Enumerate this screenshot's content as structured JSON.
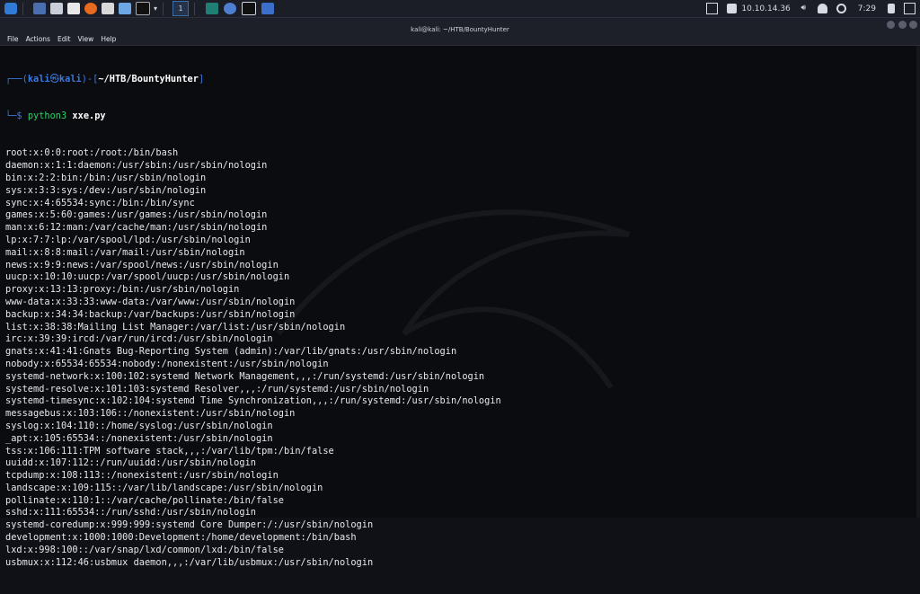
{
  "taskbar": {
    "workspace": "1",
    "ip": "10.10.14.36",
    "time": "7:29"
  },
  "window": {
    "title": "kali@kali: ~/HTB/BountyHunter",
    "menu": [
      "File",
      "Actions",
      "Edit",
      "View",
      "Help"
    ]
  },
  "prompt": {
    "user": "kali",
    "host": "kali",
    "cwd": "~/HTB/BountyHunter",
    "cmd_program": "python3",
    "cmd_arg": "xxe.py"
  },
  "output": [
    "root:x:0:0:root:/root:/bin/bash",
    "daemon:x:1:1:daemon:/usr/sbin:/usr/sbin/nologin",
    "bin:x:2:2:bin:/bin:/usr/sbin/nologin",
    "sys:x:3:3:sys:/dev:/usr/sbin/nologin",
    "sync:x:4:65534:sync:/bin:/bin/sync",
    "games:x:5:60:games:/usr/games:/usr/sbin/nologin",
    "man:x:6:12:man:/var/cache/man:/usr/sbin/nologin",
    "lp:x:7:7:lp:/var/spool/lpd:/usr/sbin/nologin",
    "mail:x:8:8:mail:/var/mail:/usr/sbin/nologin",
    "news:x:9:9:news:/var/spool/news:/usr/sbin/nologin",
    "uucp:x:10:10:uucp:/var/spool/uucp:/usr/sbin/nologin",
    "proxy:x:13:13:proxy:/bin:/usr/sbin/nologin",
    "www-data:x:33:33:www-data:/var/www:/usr/sbin/nologin",
    "backup:x:34:34:backup:/var/backups:/usr/sbin/nologin",
    "list:x:38:38:Mailing List Manager:/var/list:/usr/sbin/nologin",
    "irc:x:39:39:ircd:/var/run/ircd:/usr/sbin/nologin",
    "gnats:x:41:41:Gnats Bug-Reporting System (admin):/var/lib/gnats:/usr/sbin/nologin",
    "nobody:x:65534:65534:nobody:/nonexistent:/usr/sbin/nologin",
    "systemd-network:x:100:102:systemd Network Management,,,:/run/systemd:/usr/sbin/nologin",
    "systemd-resolve:x:101:103:systemd Resolver,,,:/run/systemd:/usr/sbin/nologin",
    "systemd-timesync:x:102:104:systemd Time Synchronization,,,:/run/systemd:/usr/sbin/nologin",
    "messagebus:x:103:106::/nonexistent:/usr/sbin/nologin",
    "syslog:x:104:110::/home/syslog:/usr/sbin/nologin",
    "_apt:x:105:65534::/nonexistent:/usr/sbin/nologin",
    "tss:x:106:111:TPM software stack,,,:/var/lib/tpm:/bin/false",
    "uuidd:x:107:112::/run/uuidd:/usr/sbin/nologin",
    "tcpdump:x:108:113::/nonexistent:/usr/sbin/nologin",
    "landscape:x:109:115::/var/lib/landscape:/usr/sbin/nologin",
    "pollinate:x:110:1::/var/cache/pollinate:/bin/false",
    "sshd:x:111:65534::/run/sshd:/usr/sbin/nologin",
    "systemd-coredump:x:999:999:systemd Core Dumper:/:/usr/sbin/nologin",
    "development:x:1000:1000:Development:/home/development:/bin/bash",
    "lxd:x:998:100::/var/snap/lxd/common/lxd:/bin/false",
    "usbmux:x:112:46:usbmux daemon,,,:/var/lib/usbmux:/usr/sbin/nologin"
  ]
}
